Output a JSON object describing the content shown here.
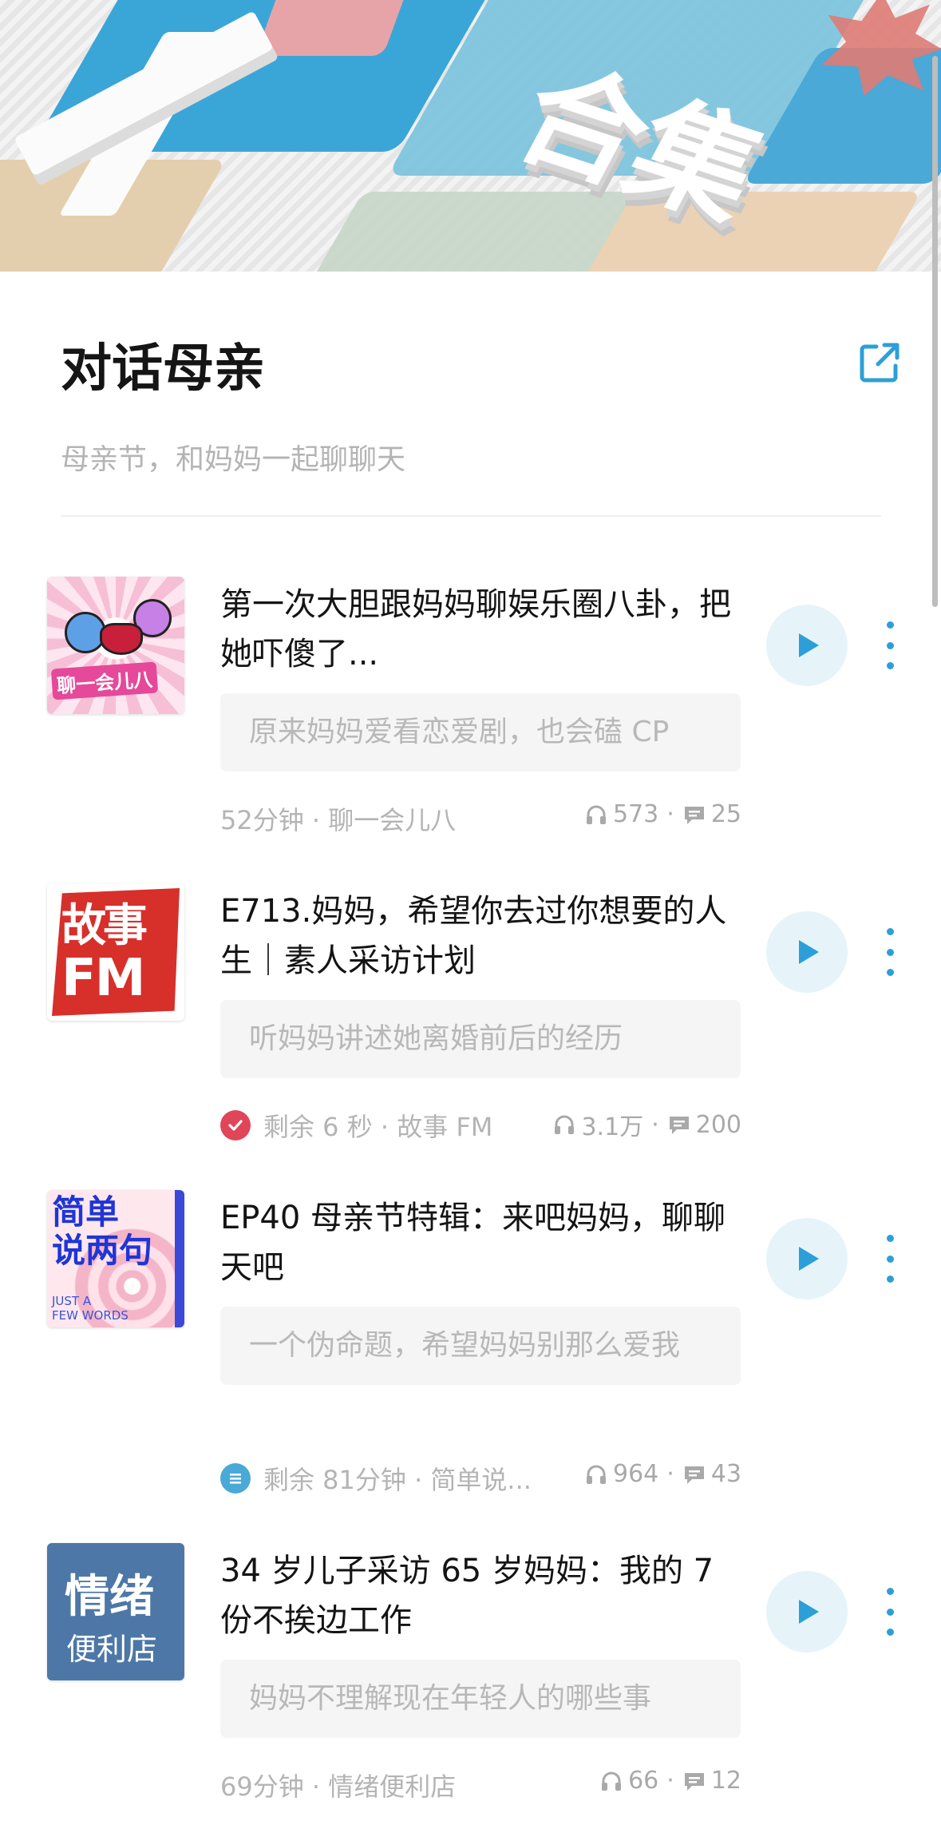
{
  "banner": {
    "artwork_text": "合集"
  },
  "header": {
    "title": "对话母亲",
    "subtitle": "母亲节，和妈妈一起聊聊天",
    "share_icon": "share-external-icon"
  },
  "colors": {
    "accent": "#2d9fd8",
    "play_bg": "#e6f4fa",
    "played_red": "#e0455a"
  },
  "episodes": [
    {
      "title": "第一次大胆跟妈妈聊娱乐圈八卦，把她吓傻了...",
      "summary": "原来妈妈爱看恋爱剧，也会磕 CP",
      "meta": "52分钟 · 聊一会儿八",
      "plays": "573",
      "comments": "25",
      "cover_text": "聊一会儿八"
    },
    {
      "title": "E713.妈妈，希望你去过你想要的人生｜素人采访计划",
      "summary": "听妈妈讲述她离婚前后的经历",
      "meta": "剩余 6 秒 · 故事 FM",
      "plays": "3.1万",
      "comments": "200",
      "cover_text": "故事",
      "cover_text2": "FM",
      "status_icon": "check-circle-icon"
    },
    {
      "title": "EP40 母亲节特辑：来吧妈妈，聊聊天吧",
      "summary": "一个伪命题，希望妈妈别那么爱我",
      "meta": "剩余 81分钟 · 简单说...",
      "plays": "964",
      "comments": "43",
      "cover_text": "简单\n说两句",
      "cover_text2": "JUST A\nFEW WORDS",
      "status_icon": "list-circle-icon"
    },
    {
      "title": "34 岁儿子采访 65 岁妈妈：我的 7份不挨边工作",
      "summary": "妈妈不理解现在年轻人的哪些事",
      "meta": "69分钟 · 情绪便利店",
      "plays": "66",
      "comments": "12",
      "cover_text": "情绪",
      "cover_text2": "便利店"
    }
  ]
}
